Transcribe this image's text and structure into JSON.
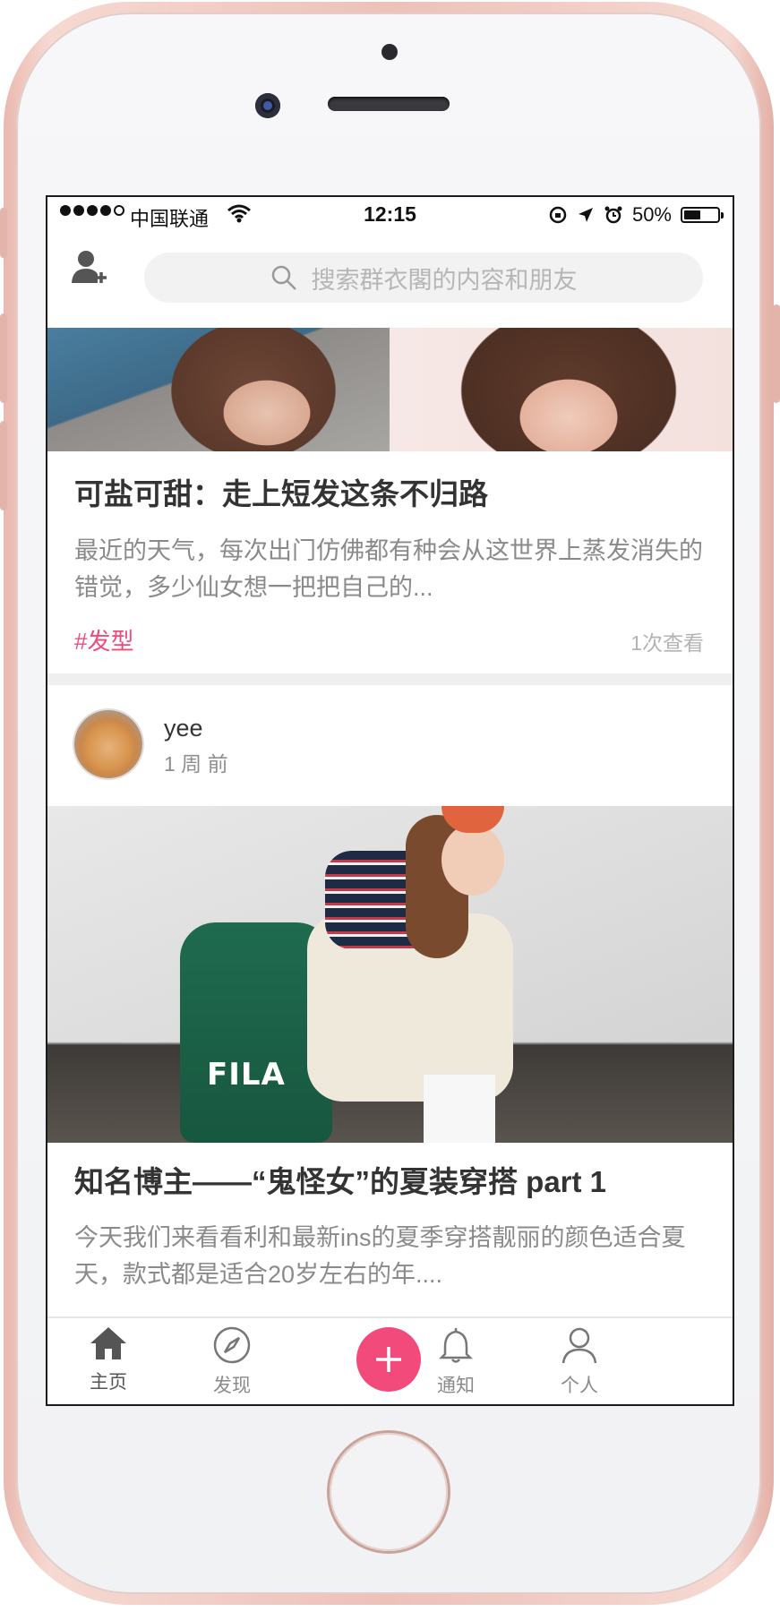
{
  "status_bar": {
    "carrier": "中国联通",
    "time": "12:15",
    "battery": "50%",
    "battery_level": 0.5
  },
  "header": {
    "search_placeholder": "搜索群衣閣的内容和朋友"
  },
  "feed": {
    "post1": {
      "title": "可盐可甜：走上短发这条不归路",
      "excerpt": "最近的天气，每次出门仿佛都有种会从这世界上蒸发消失的错觉，多少仙女想一把把自己的...",
      "tag": "#发型",
      "views": "1次查看"
    },
    "post2": {
      "author": "yee",
      "time": "1 周 前",
      "image_text": "FILA",
      "title": "知名博主——“鬼怪女”的夏装穿搭 part 1",
      "excerpt": "今天我们来看看利和最新ins的夏季穿搭靓丽的颜色适合夏天，款式都是适合20岁左右的年...."
    }
  },
  "tabs": [
    {
      "label": "主页",
      "icon": "home-icon",
      "active": true
    },
    {
      "label": "发现",
      "icon": "compass-icon",
      "active": false
    },
    {
      "label": "",
      "icon": "plus-icon",
      "active": false
    },
    {
      "label": "通知",
      "icon": "bell-icon",
      "active": false
    },
    {
      "label": "个人",
      "icon": "person-icon",
      "active": false
    }
  ],
  "colors": {
    "accent": "#f24b7b",
    "tag": "#ef4a7b"
  }
}
